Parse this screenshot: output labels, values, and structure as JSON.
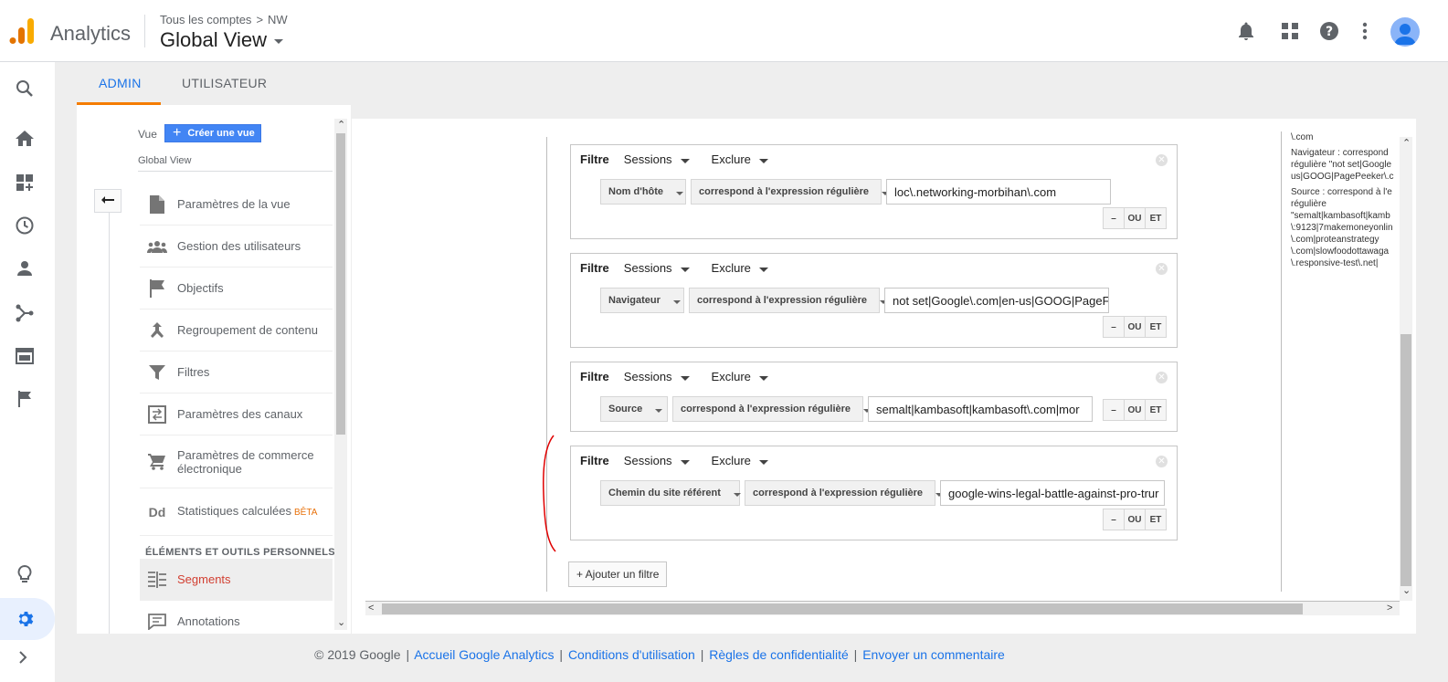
{
  "header": {
    "app_name": "Analytics",
    "breadcrumb": {
      "account": "Tous les comptes",
      "property": "NW"
    },
    "view_title": "Global View",
    "icons": [
      "notifications-icon",
      "apps-grid-icon",
      "help-icon",
      "more-vert-icon",
      "account-avatar"
    ]
  },
  "rail": {
    "icons": [
      "search-icon",
      "home-icon",
      "customization-icon",
      "realtime-icon",
      "audience-icon",
      "acquisition-icon",
      "behavior-icon",
      "conversions-icon",
      "insights-icon",
      "admin-gear-icon",
      "expand-icon"
    ]
  },
  "tabs": [
    {
      "label": "ADMIN",
      "active": true
    },
    {
      "label": "UTILISATEUR",
      "active": false
    }
  ],
  "nav": {
    "vue_label": "Vue",
    "create_button": "Créer une vue",
    "view_name": "Global View",
    "items": [
      {
        "label": "Paramètres de la vue",
        "icon": "document-icon"
      },
      {
        "label": "Gestion des utilisateurs",
        "icon": "users-icon"
      },
      {
        "label": "Objectifs",
        "icon": "flag-icon"
      },
      {
        "label": "Regroupement de contenu",
        "icon": "grouping-icon"
      },
      {
        "label": "Filtres",
        "icon": "filter-icon"
      },
      {
        "label": "Paramètres des canaux",
        "icon": "channels-icon"
      },
      {
        "label": "Paramètres de commerce électronique",
        "icon": "cart-icon"
      },
      {
        "label": "Statistiques calculées",
        "badge": "BÊTA",
        "icon": "dd-icon"
      }
    ],
    "section_header": "ÉLÉMENTS ET OUTILS PERSONNELS",
    "personal_items": [
      {
        "label": "Segments",
        "icon": "segments-icon",
        "active": true
      },
      {
        "label": "Annotations",
        "icon": "annotations-icon"
      }
    ]
  },
  "filters": [
    {
      "title": "Filtre",
      "scope": "Sessions",
      "action": "Exclure",
      "dimension": "Nom d'hôte",
      "match": "correspond à l'expression régulière",
      "value": "loc\\.networking-morbihan\\.com"
    },
    {
      "title": "Filtre",
      "scope": "Sessions",
      "action": "Exclure",
      "dimension": "Navigateur",
      "match": "correspond à l'expression régulière",
      "value": "not set|Google\\.com|en-us|GOOG|PageF"
    },
    {
      "title": "Filtre",
      "scope": "Sessions",
      "action": "Exclure",
      "dimension": "Source",
      "match": "correspond à l'expression régulière",
      "value": "semalt|kambasoft|kambasoft\\.com|mor"
    },
    {
      "title": "Filtre",
      "scope": "Sessions",
      "action": "Exclure",
      "dimension": "Chemin du site référent",
      "match": "correspond à l'expression régulière",
      "value": "google-wins-legal-battle-against-pro-trur"
    }
  ],
  "logic_buttons": {
    "minus": "–",
    "or": "OU",
    "and": "ET"
  },
  "add_filter": "+ Ajouter un filtre",
  "summary_lines": [
    "\\.com",
    "Navigateur : correspond",
    "régulière \"not set|Google",
    "us|GOOG|PagePeeker\\.c",
    "Source : correspond à l'e",
    "régulière",
    "\"semalt|kambasoft|kamb",
    "\\:9123|7makemoneyonlin",
    "\\.com|proteanstrategy",
    "\\.com|slowfoodottawaga",
    "\\.responsive-test\\.net|"
  ],
  "footer": {
    "copyright": "© 2019 Google",
    "links": [
      "Accueil Google Analytics",
      "Conditions d'utilisation",
      "Règles de confidentialité",
      "Envoyer un commentaire"
    ]
  },
  "colors": {
    "accent_blue": "#1a73e8",
    "tab_underline": "#f57c00",
    "active_segment": "#d23f31",
    "annotation_red": "#e00000"
  }
}
